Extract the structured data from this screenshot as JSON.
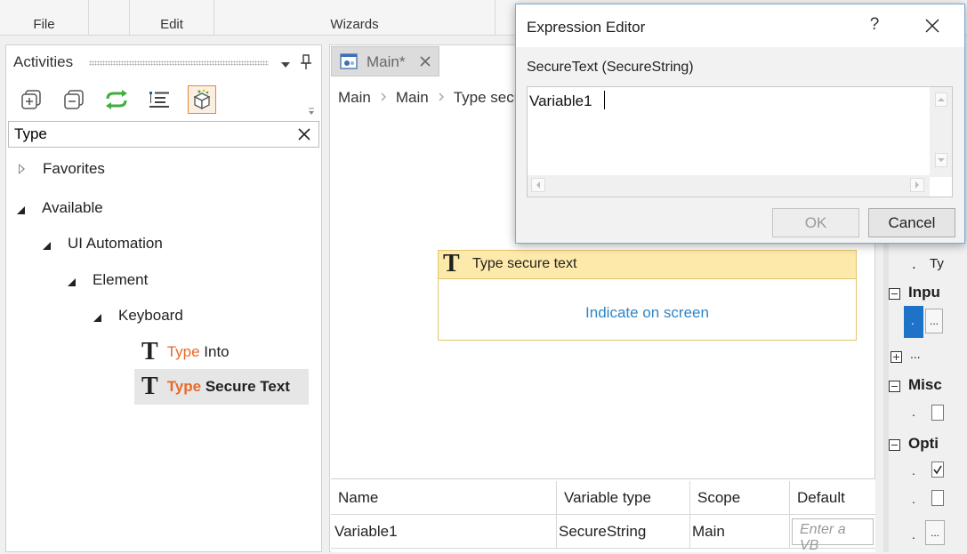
{
  "ribbon": {
    "groups": [
      {
        "label": "File"
      },
      {
        "label": "Edit"
      },
      {
        "label": "Wizards"
      }
    ]
  },
  "activities": {
    "title": "Activities",
    "search_value": "Type",
    "tree": {
      "favorites": "Favorites",
      "available": "Available",
      "ui_automation": "UI Automation",
      "element": "Element",
      "keyboard": "Keyboard",
      "type_into": {
        "highlight": "Type",
        "rest": " Into"
      },
      "type_secure_text": {
        "highlight": "Type",
        "rest": " Secure Text"
      }
    }
  },
  "designer": {
    "tab_label": "Main*",
    "breadcrumbs": [
      "Main",
      "Main",
      "Type secu"
    ],
    "activity": {
      "title": "Type secure text",
      "indicate_label": "Indicate on screen"
    }
  },
  "variables": {
    "headers": [
      "Name",
      "Variable type",
      "Scope",
      "Default"
    ],
    "rows": [
      {
        "name": "Variable1",
        "type": "SecureString",
        "scope": "Main",
        "default_placeholder": "Enter a VB"
      }
    ]
  },
  "properties": {
    "items": [
      {
        "label": "Ty"
      },
      {
        "label": "Inpu"
      },
      {
        "label": "..."
      },
      {
        "label": "Misc"
      },
      {
        "label": "Opti"
      }
    ]
  },
  "dialog": {
    "title": "Expression Editor",
    "help": "?",
    "subtitle": "SecureText (SecureString)",
    "expression": "Variable1",
    "ok_label": "OK",
    "cancel_label": "Cancel"
  },
  "colors": {
    "accent_orange": "#e86a2a",
    "activity_header": "#fde9a9",
    "activity_border": "#e3c56d",
    "link_blue": "#2f86c7",
    "selection_blue": "#1e73c8"
  }
}
